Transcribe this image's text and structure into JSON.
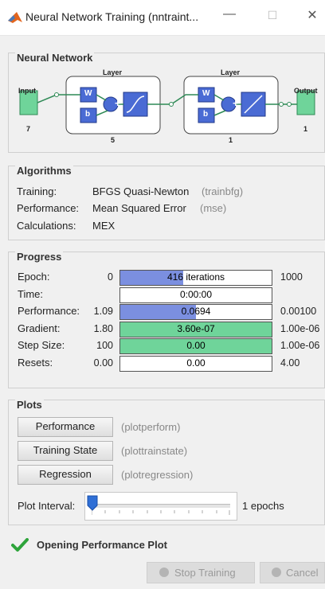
{
  "window": {
    "title": "Neural Network Training (nntraint...",
    "minimize": "—",
    "maximize": "☐",
    "close": "✕"
  },
  "network": {
    "section_title": "Neural Network",
    "input_label": "Input",
    "input_size": "7",
    "output_label": "Output",
    "output_size": "1",
    "layer1_label": "Layer",
    "layer1_size": "5",
    "layer2_label": "Layer",
    "layer2_size": "1",
    "w_label": "W",
    "b_label": "b"
  },
  "algorithms": {
    "section_title": "Algorithms",
    "rows": [
      {
        "label": "Training:",
        "value": "BFGS Quasi-Newton",
        "fn": "(trainbfg)"
      },
      {
        "label": "Performance:",
        "value": "Mean Squared Error",
        "fn": "(mse)"
      },
      {
        "label": "Calculations:",
        "value": "MEX",
        "fn": ""
      }
    ]
  },
  "progress": {
    "section_title": "Progress",
    "rows": [
      {
        "label": "Epoch:",
        "start": "0",
        "current": "416 iterations",
        "end": "1000",
        "fill": 0.416,
        "color": "#7b8fe0"
      },
      {
        "label": "Time:",
        "start": "",
        "current": "0:00:00",
        "end": "",
        "fill": 0,
        "color": "#7b8fe0"
      },
      {
        "label": "Performance:",
        "start": "1.09",
        "current": "0.0694",
        "end": "0.00100",
        "fill": 0.5,
        "color": "#7b8fe0"
      },
      {
        "label": "Gradient:",
        "start": "1.80",
        "current": "3.60e-07",
        "end": "1.00e-06",
        "fill": 1.0,
        "color": "#6fd49a"
      },
      {
        "label": "Step Size:",
        "start": "100",
        "current": "0.00",
        "end": "1.00e-06",
        "fill": 1.0,
        "color": "#6fd49a"
      },
      {
        "label": "Resets:",
        "start": "0.00",
        "current": "0.00",
        "end": "4.00",
        "fill": 0,
        "color": "#7b8fe0"
      }
    ]
  },
  "plots": {
    "section_title": "Plots",
    "buttons": [
      {
        "label": "Performance",
        "fn": "(plotperform)"
      },
      {
        "label": "Training State",
        "fn": "(plottrainstate)"
      },
      {
        "label": "Regression",
        "fn": "(plotregression)"
      }
    ],
    "interval_label": "Plot Interval:",
    "interval_value": "1 epochs",
    "interval_level": 0
  },
  "status": {
    "message": "Opening Performance Plot"
  },
  "footer": {
    "stop_label": "Stop Training",
    "cancel_label": "Cancel"
  }
}
